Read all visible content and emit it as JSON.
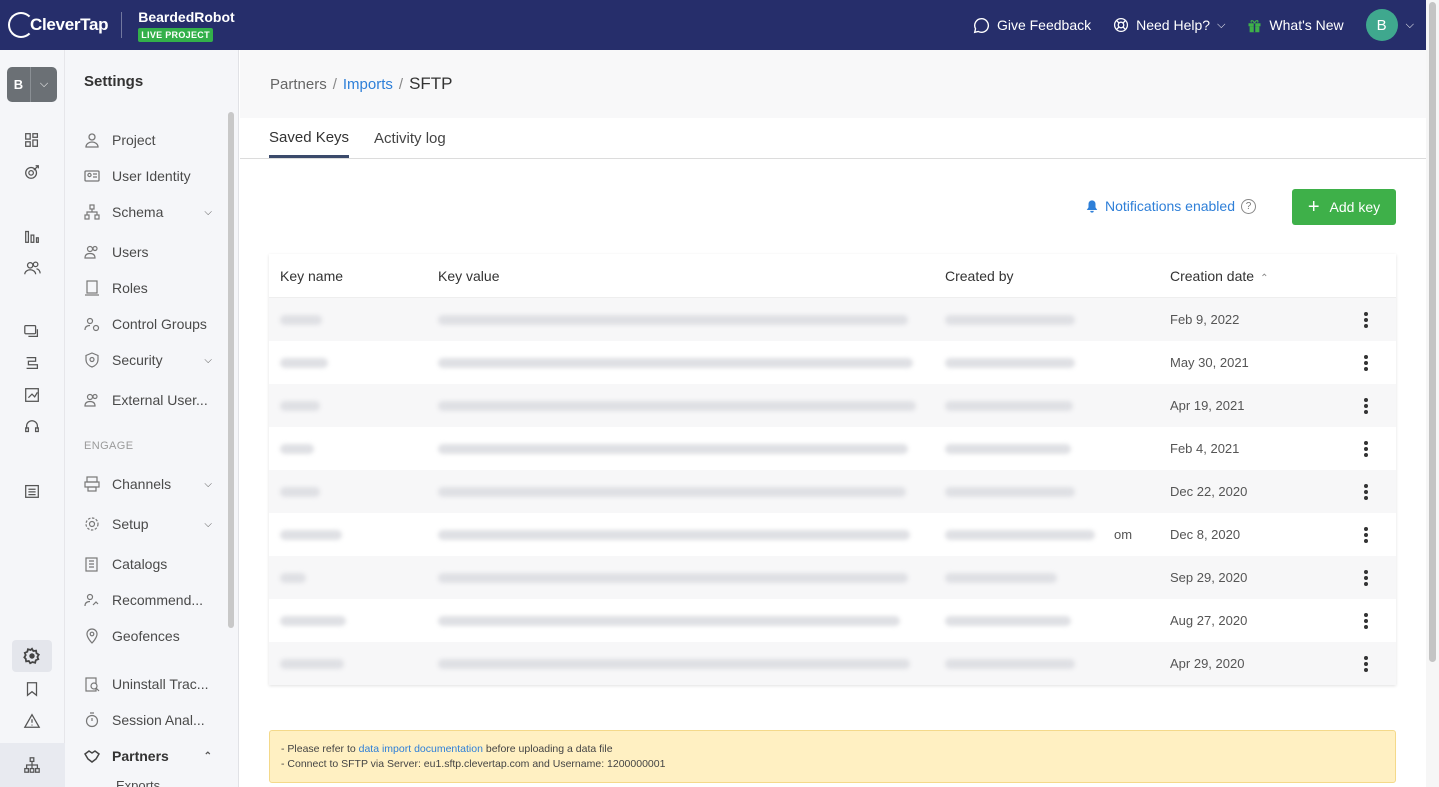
{
  "topbar": {
    "logo_text": "CleverTap",
    "project_name": "BeardedRobot",
    "project_badge": "LIVE PROJECT",
    "feedback_label": "Give Feedback",
    "help_label": "Need Help?",
    "whats_new_label": "What's New",
    "avatar_initial": "B"
  },
  "rail": {
    "project_initial": "B",
    "icons": [
      "dashboard-icon",
      "engage-icon",
      "analytics-icon",
      "segments-icon",
      "messages-icon",
      "journeys-icon",
      "campaigns-icon",
      "support-icon",
      "catalog-icon",
      "settings-icon",
      "bookmark-icon",
      "alert-icon",
      "hierarchy-icon"
    ]
  },
  "sidebar": {
    "title": "Settings",
    "items": [
      {
        "label": "Project"
      },
      {
        "label": "User Identity"
      },
      {
        "label": "Schema"
      },
      {
        "label": "Users"
      },
      {
        "label": "Roles"
      },
      {
        "label": "Control Groups"
      },
      {
        "label": "Security"
      },
      {
        "label": "External User..."
      },
      {
        "label": "Channels"
      },
      {
        "label": "Setup"
      },
      {
        "label": "Catalogs"
      },
      {
        "label": "Recommend..."
      },
      {
        "label": "Geofences"
      },
      {
        "label": "Uninstall Trac..."
      },
      {
        "label": "Session Anal..."
      },
      {
        "label": "Partners"
      },
      {
        "label": "Exports"
      }
    ],
    "section_engage": "ENGAGE"
  },
  "breadcrumb": {
    "root": "Partners",
    "link": "Imports",
    "current": "SFTP",
    "separator": "/"
  },
  "tabs": [
    {
      "label": "Saved Keys",
      "active": true
    },
    {
      "label": "Activity log",
      "active": false
    }
  ],
  "toolbar": {
    "notifications_label": "Notifications enabled",
    "add_key_label": "Add key"
  },
  "table": {
    "columns": [
      "Key name",
      "Key value",
      "Created by",
      "Creation date"
    ],
    "rows": [
      {
        "date": "Feb 9, 2022",
        "suffix": ""
      },
      {
        "date": "May 30, 2021",
        "suffix": ""
      },
      {
        "date": "Apr 19, 2021",
        "suffix": ""
      },
      {
        "date": "Feb 4, 2021",
        "suffix": ""
      },
      {
        "date": "Dec 22, 2020",
        "suffix": ""
      },
      {
        "date": "Dec 8, 2020",
        "suffix": "om"
      },
      {
        "date": "Sep 29, 2020",
        "suffix": ""
      },
      {
        "date": "Aug 27, 2020",
        "suffix": ""
      },
      {
        "date": "Apr 29, 2020",
        "suffix": ""
      }
    ]
  },
  "note": {
    "line1_prefix": "- Please refer to ",
    "line1_link": "data import documentation",
    "line1_suffix": " before uploading a data file",
    "line2": "- Connect to SFTP via Server: eu1.sftp.clevertap.com and Username: 1200000001"
  },
  "colors": {
    "topbar_bg": "#262e6b",
    "accent_green": "#3eb049",
    "link_blue": "#2e7fd8",
    "note_bg": "#fff0c2"
  }
}
